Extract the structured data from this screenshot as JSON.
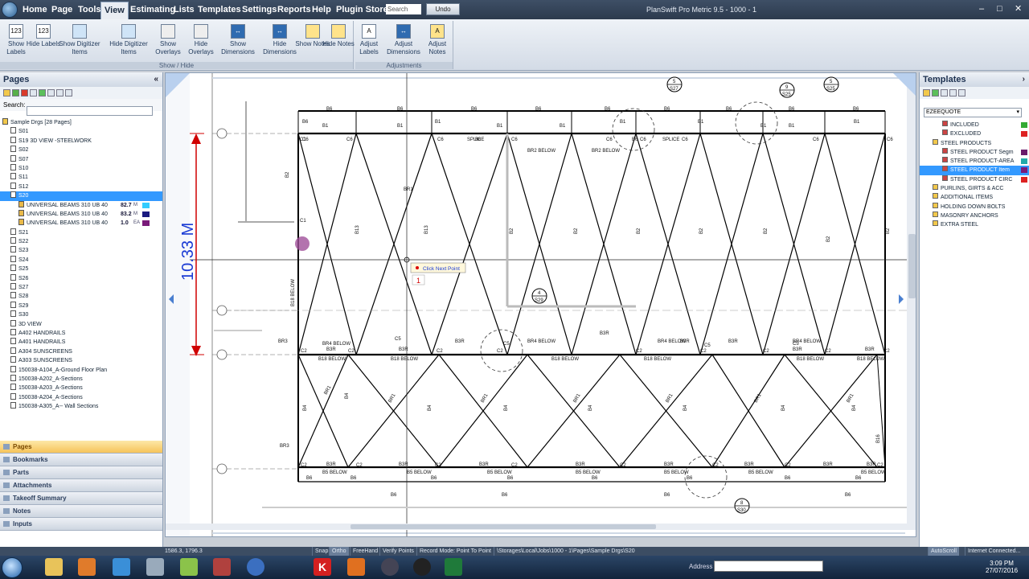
{
  "menubar": {
    "items": [
      "Home",
      "Page",
      "Tools",
      "View",
      "Estimating",
      "Lists",
      "Templates",
      "Settings",
      "Reports",
      "Help",
      "Plugin Store"
    ],
    "active": "View",
    "search_placeholder": "Search",
    "undo_label": "Undo",
    "window_title": "PlanSwift Pro Metric 9.5 - 1000 - 1"
  },
  "ribbon": {
    "show_hide_buttons": [
      {
        "label": "Show Labels",
        "icon": "label-123-icon"
      },
      {
        "label": "Hide Labels",
        "icon": "label-123-icon"
      },
      {
        "label": "Show Digitizer Items",
        "icon": "digitizer-icon"
      },
      {
        "label": "Hide Digitizer Items",
        "icon": "digitizer-icon"
      },
      {
        "label": "Show Overlays",
        "icon": "overlay-icon"
      },
      {
        "label": "Hide Overlays",
        "icon": "overlay-icon"
      },
      {
        "label": "Show Dimensions",
        "icon": "dimension-icon"
      },
      {
        "label": "Hide Dimensions",
        "icon": "dimension-icon"
      },
      {
        "label": "Show Notes",
        "icon": "note-icon"
      },
      {
        "label": "Hide Notes",
        "icon": "note-icon"
      }
    ],
    "show_hide_group": "Show / Hide",
    "adjust_buttons": [
      {
        "label": "Adjust Labels",
        "icon": "adjust-label-icon"
      },
      {
        "label": "Adjust Dimensions",
        "icon": "adjust-dimension-icon"
      },
      {
        "label": "Adjust Notes",
        "icon": "adjust-note-icon"
      }
    ],
    "adjust_group": "Adjustments"
  },
  "pages_panel": {
    "title": "Pages",
    "search_label": "Search:",
    "root": "Sample Drgs [28 Pages]",
    "pages_before": [
      "S01",
      "S19 3D VIEW -STEELWORK",
      "S02",
      "S07",
      "S10",
      "S11",
      "S12"
    ],
    "selected_page": "S20",
    "takeoff_items": [
      {
        "name": "UNIVERSAL BEAMS 310 UB 40",
        "value": "82.7",
        "unit": "M",
        "color": "#33ccff"
      },
      {
        "name": "UNIVERSAL BEAMS 310 UB 40",
        "value": "83.2",
        "unit": "M",
        "color": "#1a1a80"
      },
      {
        "name": "UNIVERSAL BEAMS 310 UB 40",
        "value": "1.0",
        "unit": "EA",
        "color": "#7a1a7a"
      }
    ],
    "pages_after": [
      "S21",
      "S22",
      "S23",
      "S24",
      "S25",
      "S26",
      "S27",
      "S28",
      "S29",
      "S30",
      "3D VIEW",
      "A402 HANDRAILS",
      "A401 HANDRAILS",
      "A304 SUNSCREENS",
      "A303 SUNSCREENS",
      "150038-A104_A-Ground Floor Plan",
      "150038-A202_A-Sections",
      "150038-A203_A-Sections",
      "150038-A204_A-Sections",
      "150038-A305_A-- Wall Sections"
    ]
  },
  "nav_panels": [
    "Pages",
    "Bookmarks",
    "Parts",
    "Attachments",
    "Takeoff Summary",
    "Notes",
    "Inputs"
  ],
  "templates_panel": {
    "title": "Templates",
    "selected_template": "EZEEQUOTE",
    "items": [
      {
        "label": "INCLUDED",
        "indent": 2,
        "color": "#33aa33"
      },
      {
        "label": "EXCLUDED",
        "indent": 2,
        "color": "#dd2222"
      },
      {
        "label": "STEEL PRODUCTS",
        "indent": 1,
        "color": ""
      },
      {
        "label": "STEEL PRODUCT Segm",
        "indent": 2,
        "color": "#6a1a6a"
      },
      {
        "label": "STEEL PRODUCT-AREA",
        "indent": 2,
        "color": "#22aaaa"
      },
      {
        "label": "STEEL PRODUCT Item",
        "indent": 2,
        "color": "#7a1a7a",
        "selected": true
      },
      {
        "label": "STEEL PRODUCT CIRC",
        "indent": 2,
        "color": "#dd2222"
      },
      {
        "label": "PURLINS, GIRTS & ACC",
        "indent": 1,
        "color": ""
      },
      {
        "label": "ADDITIONAL ITEMS",
        "indent": 1,
        "color": ""
      },
      {
        "label": "HOLDING DOWN BOLTS",
        "indent": 1,
        "color": ""
      },
      {
        "label": "MASONRY ANCHORS",
        "indent": 1,
        "color": ""
      },
      {
        "label": "EXTRA STEEL",
        "indent": 1,
        "color": ""
      }
    ]
  },
  "drawing": {
    "dimension_text": "10.33 M",
    "tooltip": "Click Next Point",
    "point_counter": "1",
    "labels": {
      "b6": "B6",
      "b1": "B1",
      "b2": "B2",
      "b3": "B3",
      "b4": "B4",
      "b5": "B5",
      "b3r": "B3R",
      "b18": "B18",
      "br1": "BR1",
      "br2": "BR2",
      "br3": "BR3",
      "br4": "BR4",
      "br6": "BR6",
      "c1": "C1",
      "c2": "C2",
      "c5": "C5",
      "c6": "C6",
      "splice": "SPLICE",
      "below": "BELOW"
    },
    "section_markers": [
      "S27",
      "S25",
      "S29",
      "S30",
      "S25"
    ],
    "section_numbers": [
      "5",
      "9",
      "4",
      "8",
      "5"
    ]
  },
  "statusbar": {
    "coords": "1586.3, 1796.3",
    "snap": "Snap",
    "ortho": "Ortho",
    "freehand": "FreeHand",
    "verify": "Verify Points",
    "record_mode": "Record Mode: Point To Point",
    "path": "\\Storages\\Local\\Jobs\\1000 - 1\\Pages\\Sample Drgs\\S20",
    "autoscroll": "AutoScroll",
    "connection": "Internet Connected..."
  },
  "taskbar": {
    "address_label": "Address",
    "time": "3:09 PM",
    "date": "27/07/2016"
  }
}
